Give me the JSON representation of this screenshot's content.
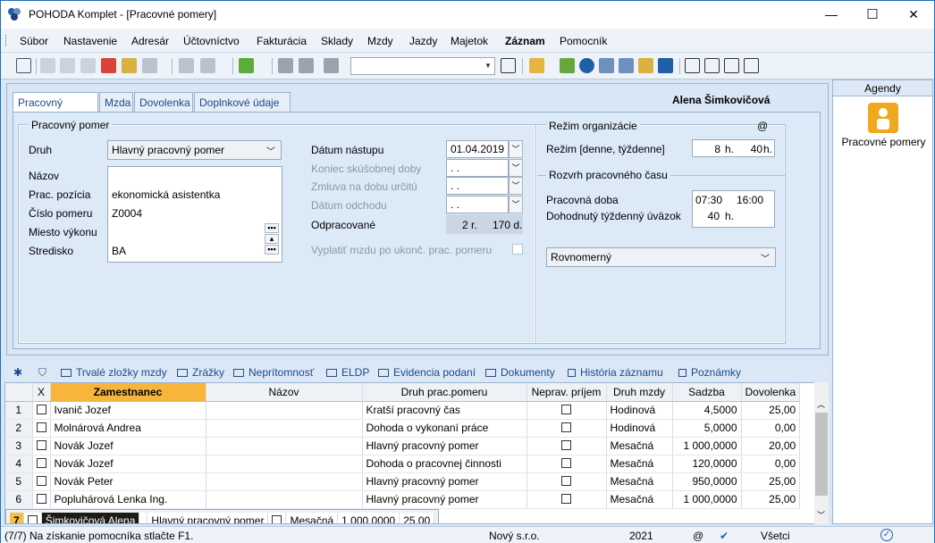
{
  "window": {
    "title": "POHODA Komplet - [Pracovné pomery]",
    "min": "—",
    "max": "☐",
    "close": "✕"
  },
  "menu": [
    "Súbor",
    "Nastavenie",
    "Adresár",
    "Účtovníctvo",
    "Fakturácia",
    "Sklady",
    "Mzdy",
    "Jazdy",
    "Majetok",
    "Záznam",
    "Pomocník"
  ],
  "tabs": [
    "Pracovný pomer",
    "Mzda",
    "Dovolenka",
    "Doplnkové údaje"
  ],
  "person": "Alena  Šimkovičová",
  "form": {
    "group_title": "Pracovný pomer",
    "druh_label": "Druh",
    "druh_value": "Hlavný pracovný pomer",
    "nazov_label": "Názov",
    "nazov_value": "",
    "pozicia_label": "Prac. pozícia",
    "pozicia_value": "ekonomická asistentka",
    "cislo_label": "Číslo pomeru",
    "cislo_value": "Z0004",
    "miesto_label": "Miesto výkonu",
    "miesto_value": "",
    "stredisko_label": "Stredisko",
    "stredisko_value": "BA",
    "nastup_label": "Dátum nástupu",
    "nastup_value": "01.04.2019",
    "skusobna_label": "Koniec skúšobnej doby",
    "skusobna_value": " .  .",
    "zmluva_label": "Zmluva na dobu určitú",
    "zmluva_value": " .  .",
    "odchod_label": "Dátum odchodu",
    "odchod_value": " .  .",
    "odprac_label": "Odpracované",
    "odprac_years": "2 r.",
    "odprac_days": "170 d.",
    "vyplatit_label": "Vyplatiť mzdu po ukonč. prac. pomeru"
  },
  "regime": {
    "title": "Režim organizácie",
    "at": "@",
    "rezim_label": "Režim  [denne, týždenne]",
    "rezim_daily": "8",
    "unit_h": "h.",
    "rezim_weekly": "40",
    "rozvrh_title": "Rozvrh pracovného času",
    "doba_label": "Pracovná doba",
    "doba_from": "07:30",
    "doba_to": "16:00",
    "uvazok_label": "Dohodnutý týždenný úväzok",
    "uvazok_value": "40",
    "rozvrh_value": "Rovnomerný"
  },
  "agendy": {
    "title": "Agendy",
    "item": "Pracovné pomery"
  },
  "bottom_tabs": [
    "Trvalé zložky mzdy",
    "Zrážky",
    "Neprítomnosť",
    "ELDP",
    "Evidencia podaní",
    "Dokumenty",
    "História záznamu",
    "Poznámky"
  ],
  "grid": {
    "headers": [
      "X",
      "Zamestnanec",
      "Názov",
      "Druh prac.pomeru",
      "Neprav. príjem",
      "Druh mzdy",
      "Sadzba",
      "Dovolenka"
    ],
    "rows": [
      {
        "n": "1",
        "name": "Ivanič Jozef",
        "druh": "Kratší pracovný čas",
        "mzda": "Hodinová",
        "sadzba": "4,5000",
        "dov": "25,00"
      },
      {
        "n": "2",
        "name": "Molnárová Andrea",
        "druh": "Dohoda o vykonaní práce",
        "mzda": "Hodinová",
        "sadzba": "5,0000",
        "dov": "0,00"
      },
      {
        "n": "3",
        "name": "Novák Jozef",
        "druh": "Hlavný pracovný pomer",
        "mzda": "Mesačná",
        "sadzba": "1 000,0000",
        "dov": "20,00"
      },
      {
        "n": "4",
        "name": "Novák Jozef",
        "druh": "Dohoda o pracovnej činnosti",
        "mzda": "Mesačná",
        "sadzba": "120,0000",
        "dov": "0,00"
      },
      {
        "n": "5",
        "name": "Novák Peter",
        "druh": "Hlavný pracovný pomer",
        "mzda": "Mesačná",
        "sadzba": "950,0000",
        "dov": "25,00"
      },
      {
        "n": "6",
        "name": "Popluhárová Lenka Ing.",
        "druh": "Hlavný pracovný pomer",
        "mzda": "Mesačná",
        "sadzba": "1 000,0000",
        "dov": "25,00"
      },
      {
        "n": "7",
        "name": "Šimkovičová Alena",
        "druh": "Hlavný pracovný pomer",
        "mzda": "Mesačná",
        "sadzba": "1 000,0000",
        "dov": "25,00"
      }
    ]
  },
  "status": {
    "hint": "(7/7) Na získanie pomocníka stlačte F1.",
    "company": "Nový s.r.o.",
    "year": "2021",
    "at": "@",
    "filter": "Všetci"
  }
}
